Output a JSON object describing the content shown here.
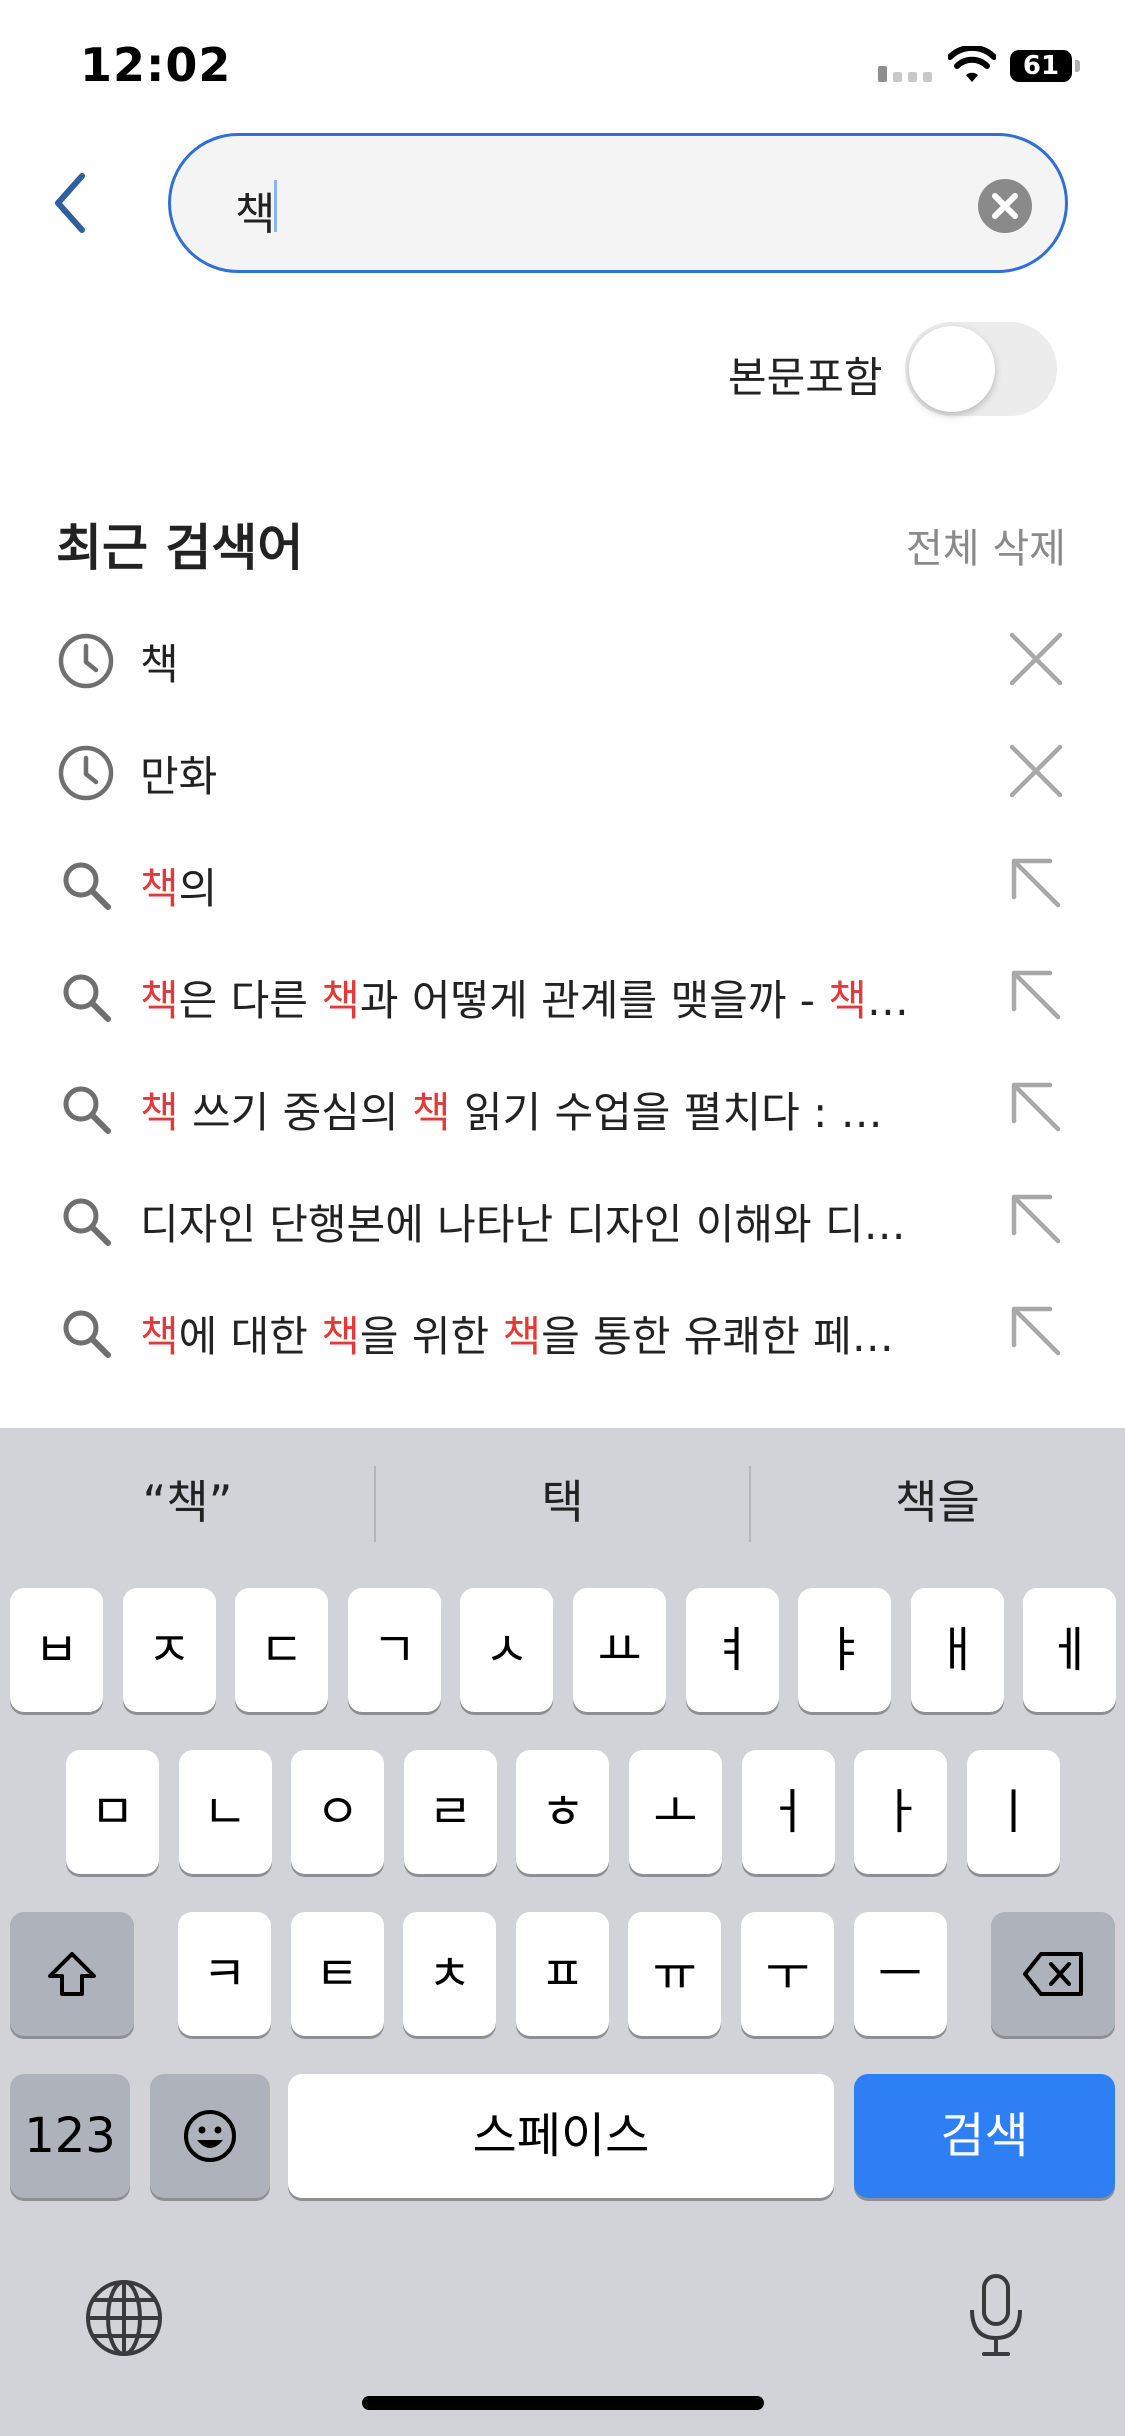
{
  "status_bar": {
    "time": "12:02",
    "battery": "61"
  },
  "search": {
    "query": "책"
  },
  "toggle": {
    "label": "본문포함",
    "on": false
  },
  "recent": {
    "title": "최근 검색어",
    "clear_all": "전체 삭제",
    "items": [
      {
        "type": "history",
        "parts": [
          {
            "t": "책",
            "hl": false
          }
        ]
      },
      {
        "type": "history",
        "parts": [
          {
            "t": "만화",
            "hl": false
          }
        ]
      },
      {
        "type": "suggestion",
        "parts": [
          {
            "t": "책",
            "hl": true
          },
          {
            "t": "의",
            "hl": false
          }
        ]
      },
      {
        "type": "suggestion",
        "parts": [
          {
            "t": "책",
            "hl": true
          },
          {
            "t": "은 다른 ",
            "hl": false
          },
          {
            "t": "책",
            "hl": true
          },
          {
            "t": "과 어떻게 관계를 맺을까 - ",
            "hl": false
          },
          {
            "t": "책",
            "hl": true
          },
          {
            "t": "…",
            "hl": false
          }
        ]
      },
      {
        "type": "suggestion",
        "parts": [
          {
            "t": "책",
            "hl": true
          },
          {
            "t": " 쓰기 중심의 ",
            "hl": false
          },
          {
            "t": "책",
            "hl": true
          },
          {
            "t": " 읽기 수업을 펼치다 : …",
            "hl": false
          }
        ]
      },
      {
        "type": "suggestion",
        "parts": [
          {
            "t": "디자인 단행본에 나타난 디자인 이해와 디…",
            "hl": false
          }
        ]
      },
      {
        "type": "suggestion",
        "parts": [
          {
            "t": "책",
            "hl": true
          },
          {
            "t": "에 대한 ",
            "hl": false
          },
          {
            "t": "책",
            "hl": true
          },
          {
            "t": "을 위한 ",
            "hl": false
          },
          {
            "t": "책",
            "hl": true
          },
          {
            "t": "을 통한 유쾌한 페…",
            "hl": false
          }
        ]
      }
    ]
  },
  "keyboard": {
    "suggestions": [
      "“책”",
      "택",
      "책을"
    ],
    "row1": [
      "ㅂ",
      "ㅈ",
      "ㄷ",
      "ㄱ",
      "ㅅ",
      "ㅛ",
      "ㅕ",
      "ㅑ",
      "ㅐ",
      "ㅔ"
    ],
    "row2": [
      "ㅁ",
      "ㄴ",
      "ㅇ",
      "ㄹ",
      "ㅎ",
      "ㅗ",
      "ㅓ",
      "ㅏ",
      "ㅣ"
    ],
    "row3": [
      "ㅋ",
      "ㅌ",
      "ㅊ",
      "ㅍ",
      "ㅠ",
      "ㅜ",
      "ㅡ"
    ],
    "numbers_label": "123",
    "space_label": "스페이스",
    "search_label": "검색"
  },
  "icons": {
    "back": "chevron-left-icon",
    "clear": "clear-icon",
    "history": "clock-icon",
    "suggestion": "search-icon",
    "delete": "close-icon",
    "fill": "arrow-up-left-icon",
    "shift": "shift-icon",
    "backspace": "backspace-icon",
    "emoji": "emoji-icon",
    "globe": "globe-icon",
    "mic": "microphone-icon"
  },
  "colors": {
    "accent": "#2f6fd6",
    "highlight": "#e53935",
    "keyboard_bg": "#d1d3d9",
    "search_key": "#2f7ff4"
  }
}
